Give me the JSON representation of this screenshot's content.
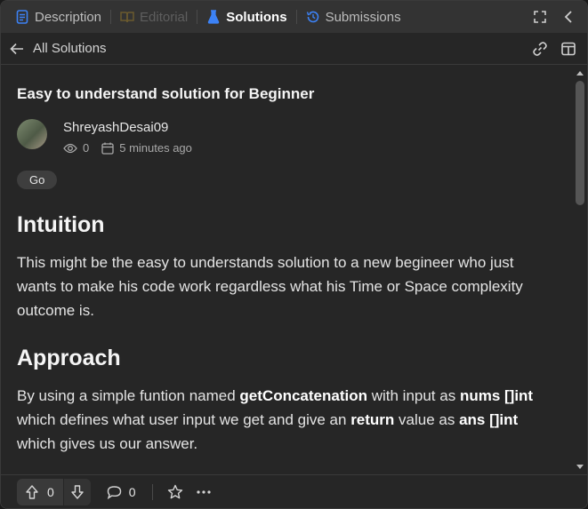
{
  "tabs": [
    {
      "label": "Description",
      "icon": "description-icon",
      "state": "normal"
    },
    {
      "label": "Editorial",
      "icon": "editorial-icon",
      "state": "disabled"
    },
    {
      "label": "Solutions",
      "icon": "flask-icon",
      "state": "active"
    },
    {
      "label": "Submissions",
      "icon": "history-icon",
      "state": "normal"
    }
  ],
  "subheader": {
    "back_label": "All Solutions"
  },
  "post": {
    "title": "Easy to understand solution for Beginner",
    "author": "ShreyashDesai09",
    "views": "0",
    "time": "5 minutes ago",
    "tag": "Go",
    "intuition_heading": "Intuition",
    "intuition_text": "This might be the easy to understands solution to a new begineer who just wants to make his code work regardless what his Time or Space complexity outcome is.",
    "approach_heading": "Approach",
    "approach": {
      "t1": "By using a simple funtion named ",
      "b1": "getConcatenation",
      "t2": " with input as ",
      "b2": "nums []int",
      "t3": " which defines what user input we get and give an ",
      "b3": "return",
      "t4": " value as ",
      "b4": "ans []int",
      "t5": " which gives us our answer."
    }
  },
  "footer": {
    "upvotes": "0",
    "comments": "0"
  },
  "colors": {
    "accent_blue": "#3c82f6",
    "background": "#262626",
    "tabbar": "#333333"
  }
}
